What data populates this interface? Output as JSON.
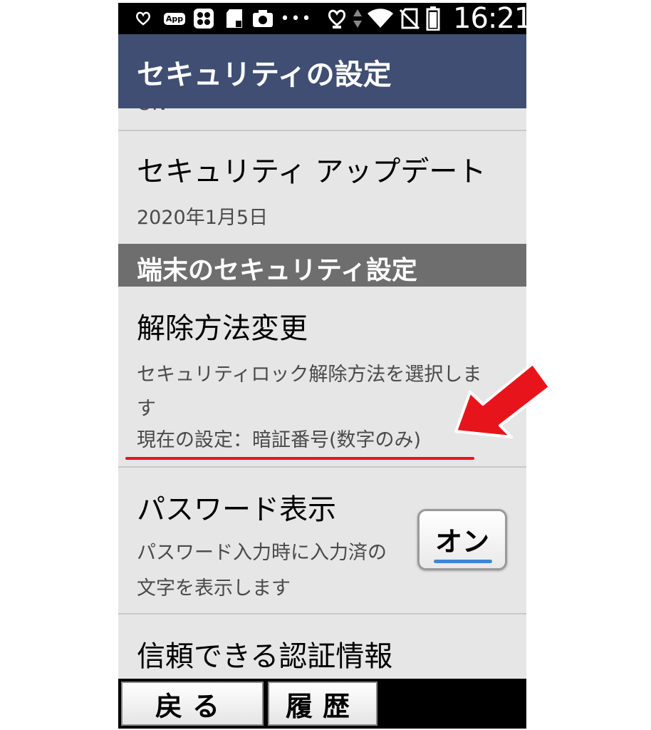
{
  "status_bar": {
    "app_label": "App",
    "time": "16:21",
    "icons": [
      "heart-notification-icon",
      "app-icon",
      "grid-icon",
      "sd-card-icon",
      "camera-icon",
      "more-icon",
      "heart-outline-icon",
      "data-arrows-icon",
      "wifi-icon",
      "no-sim-icon",
      "battery-icon"
    ]
  },
  "header": {
    "title": "セキュリティの設定"
  },
  "list": {
    "cut_off_text": "ON",
    "security_update": {
      "title": "セキュリティ アップデート",
      "date": "2020年1月5日"
    },
    "section_title": "端末のセキュリティ設定",
    "unlock_method": {
      "title": "解除方法変更",
      "desc_line1": "セキュリティロック解除方法を選択しま",
      "desc_line2": "す",
      "current": "現在の設定：暗証番号(数字のみ)"
    },
    "password_display": {
      "title": "パスワード表示",
      "desc_line1": "パスワード入力時に入力済の",
      "desc_line2": "文字を表示します",
      "toggle_label": "オン"
    },
    "trusted_credentials": {
      "title": "信頼できる認証情報"
    }
  },
  "bottom_nav": {
    "back": "戻る",
    "history": "履歴"
  },
  "colors": {
    "accent_header": "#3f4e72",
    "section_bg": "#6e6e6e",
    "annotation_red": "#e8141b",
    "toggle_underline": "#3f86d6"
  }
}
